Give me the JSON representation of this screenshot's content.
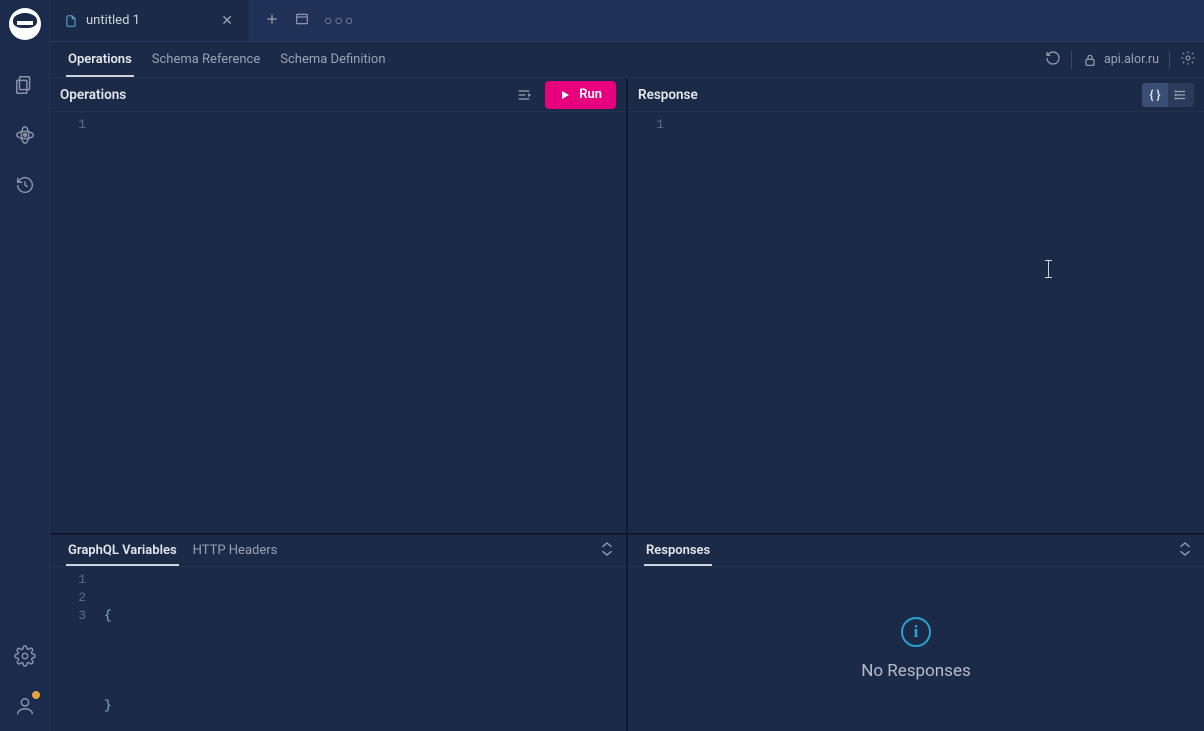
{
  "tabs": {
    "items": [
      {
        "label": "untitled 1"
      }
    ]
  },
  "subtabs": {
    "operations": "Operations",
    "schema_ref": "Schema Reference",
    "schema_def": "Schema Definition",
    "endpoint": "api.alor.ru"
  },
  "left_pane": {
    "title": "Operations",
    "run_label": "Run",
    "lines": [
      "1"
    ],
    "code": [
      ""
    ]
  },
  "right_pane": {
    "title": "Response",
    "lines": [
      "1"
    ],
    "code": [
      ""
    ]
  },
  "bottom_left": {
    "tab_vars": "GraphQL Variables",
    "tab_headers": "HTTP Headers",
    "lines": [
      "1",
      "2",
      "3"
    ],
    "code": [
      "{",
      "",
      "}"
    ]
  },
  "bottom_right": {
    "title": "Responses",
    "empty_msg": "No Responses"
  }
}
